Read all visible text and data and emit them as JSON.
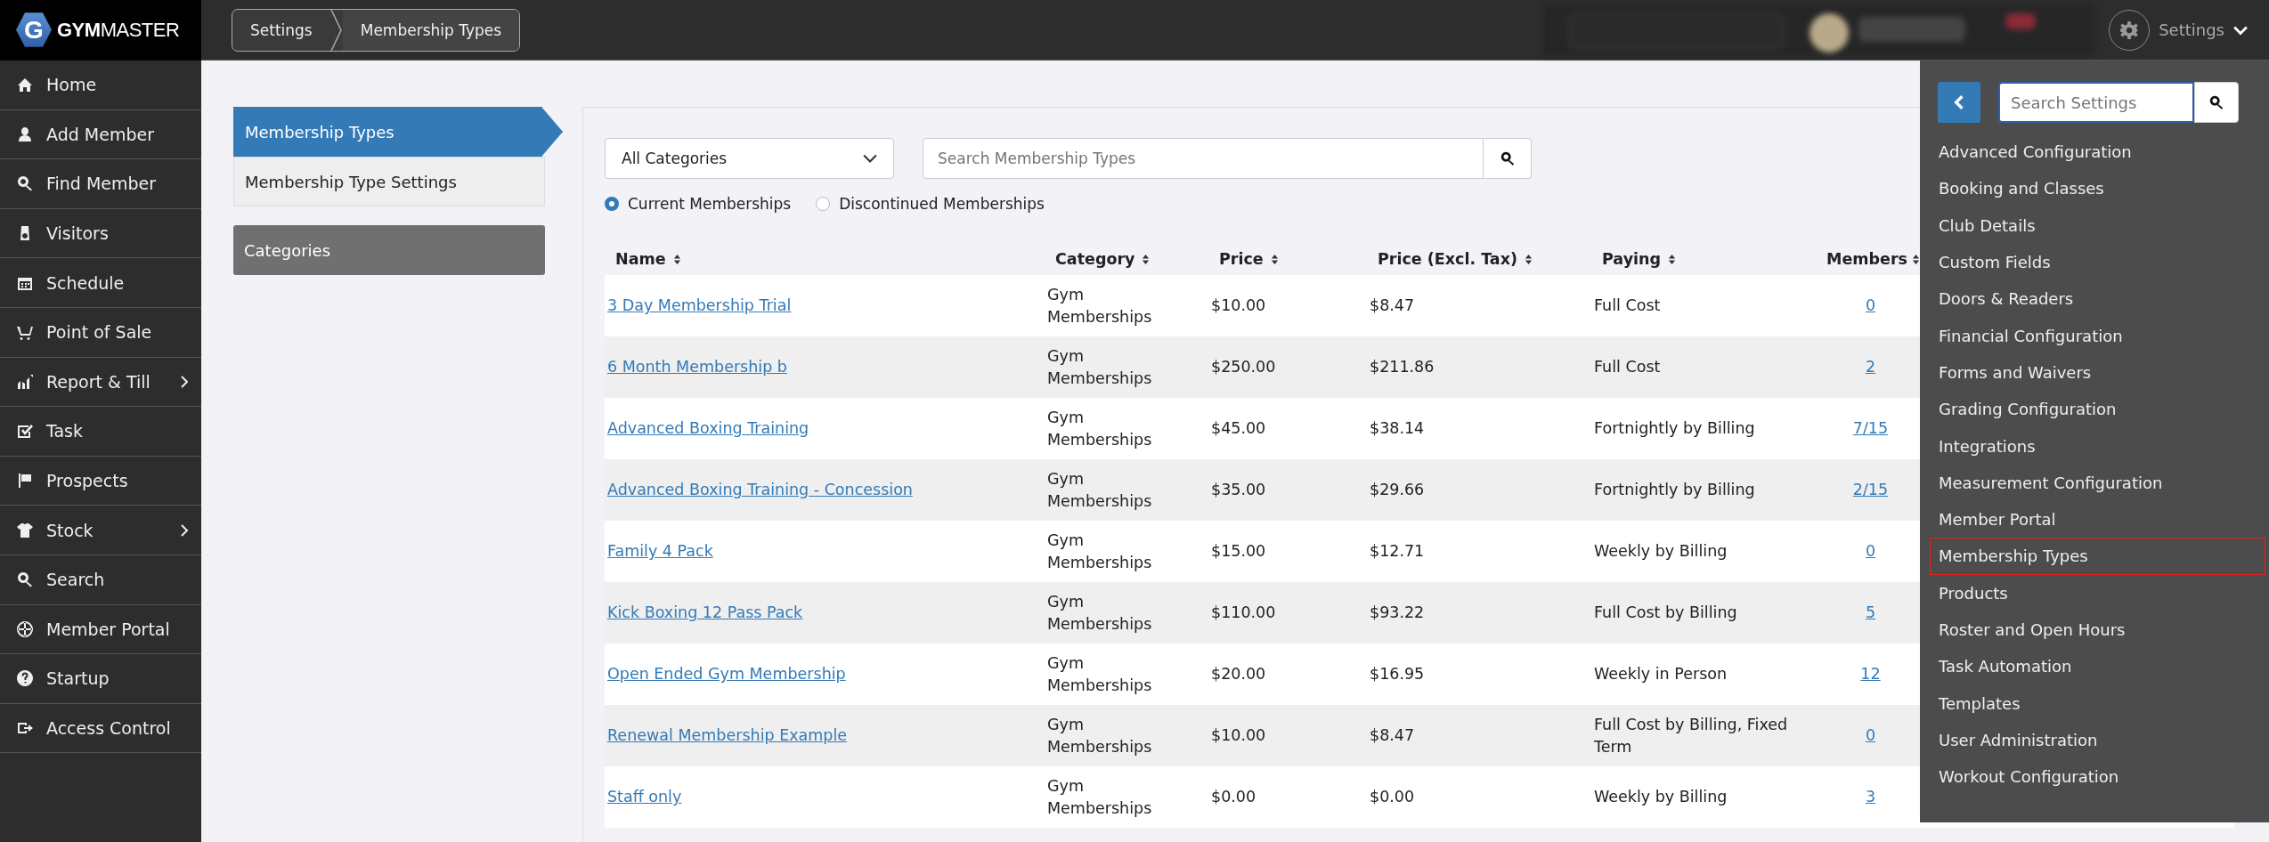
{
  "brand": {
    "logo_letter": "G",
    "name_bold": "GYM",
    "name_rest": "MASTER"
  },
  "breadcrumb": [
    "Settings",
    "Membership Types"
  ],
  "top_bar": {
    "settings_label": "Settings"
  },
  "sidebar": {
    "items": [
      {
        "label": "Home",
        "kind": "home",
        "has_submenu": false
      },
      {
        "label": "Add Member",
        "kind": "person",
        "has_submenu": false
      },
      {
        "label": "Find Member",
        "kind": "search",
        "has_submenu": false
      },
      {
        "label": "Visitors",
        "kind": "tag",
        "has_submenu": false
      },
      {
        "label": "Schedule",
        "kind": "calendar",
        "has_submenu": false
      },
      {
        "label": "Point of Sale",
        "kind": "cart",
        "has_submenu": false
      },
      {
        "label": "Report & Till",
        "kind": "chart",
        "has_submenu": true
      },
      {
        "label": "Task",
        "kind": "check",
        "has_submenu": false
      },
      {
        "label": "Prospects",
        "kind": "flag",
        "has_submenu": false
      },
      {
        "label": "Stock",
        "kind": "shirt",
        "has_submenu": true
      },
      {
        "label": "Search",
        "kind": "search",
        "has_submenu": false
      },
      {
        "label": "Member Portal",
        "kind": "globe",
        "has_submenu": false
      },
      {
        "label": "Startup",
        "kind": "question",
        "has_submenu": false
      },
      {
        "label": "Access Control",
        "kind": "exit",
        "has_submenu": false
      }
    ]
  },
  "subnav": {
    "items": [
      {
        "label": "Membership Types",
        "selected": true
      },
      {
        "label": "Membership Type Settings",
        "selected": false
      }
    ],
    "categories_button": "Categories"
  },
  "filters": {
    "category_select": "All Categories",
    "search": {
      "placeholder": "Search Membership Types"
    },
    "radios": [
      {
        "label": "Current Memberships",
        "selected": true
      },
      {
        "label": "Discontinued Memberships",
        "selected": false
      }
    ]
  },
  "table": {
    "columns": [
      "Name",
      "Category",
      "Price",
      "Price (Excl. Tax)",
      "Paying",
      "Members"
    ],
    "rows": [
      {
        "name": "3 Day Membership Trial",
        "category": "Gym Memberships",
        "price": "$10.00",
        "price_excl_tax": "$8.47",
        "paying": "Full Cost",
        "members": "0"
      },
      {
        "name": "6 Month Membership b",
        "category": "Gym Memberships",
        "price": "$250.00",
        "price_excl_tax": "$211.86",
        "paying": "Full Cost",
        "members": "2"
      },
      {
        "name": "Advanced Boxing Training",
        "category": "Gym Memberships",
        "price": "$45.00",
        "price_excl_tax": "$38.14",
        "paying": "Fortnightly by Billing",
        "members": "7/15"
      },
      {
        "name": "Advanced Boxing Training - Concession",
        "category": "Gym Memberships",
        "price": "$35.00",
        "price_excl_tax": "$29.66",
        "paying": "Fortnightly by Billing",
        "members": "2/15"
      },
      {
        "name": "Family 4 Pack",
        "category": "Gym Memberships",
        "price": "$15.00",
        "price_excl_tax": "$12.71",
        "paying": "Weekly by Billing",
        "members": "0"
      },
      {
        "name": "Kick Boxing 12 Pass Pack",
        "category": "Gym Memberships",
        "price": "$110.00",
        "price_excl_tax": "$93.22",
        "paying": "Full Cost by Billing",
        "members": "5"
      },
      {
        "name": "Open Ended Gym Membership",
        "category": "Gym Memberships",
        "price": "$20.00",
        "price_excl_tax": "$16.95",
        "paying": "Weekly in Person",
        "members": "12"
      },
      {
        "name": "Renewal Membership Example",
        "category": "Gym Memberships",
        "price": "$10.00",
        "price_excl_tax": "$8.47",
        "paying": "Full Cost by Billing, Fixed Term",
        "members": "0"
      },
      {
        "name": "Staff only",
        "category": "Gym Memberships",
        "price": "$0.00",
        "price_excl_tax": "$0.00",
        "paying": "Weekly by Billing",
        "members": "3"
      }
    ]
  },
  "settings_panel": {
    "search": {
      "placeholder": "Search Settings"
    },
    "items": [
      {
        "label": "Advanced Configuration",
        "selected": false
      },
      {
        "label": "Booking and Classes",
        "selected": false
      },
      {
        "label": "Club Details",
        "selected": false
      },
      {
        "label": "Custom Fields",
        "selected": false
      },
      {
        "label": "Doors & Readers",
        "selected": false
      },
      {
        "label": "Financial Configuration",
        "selected": false
      },
      {
        "label": "Forms and Waivers",
        "selected": false
      },
      {
        "label": "Grading Configuration",
        "selected": false
      },
      {
        "label": "Integrations",
        "selected": false
      },
      {
        "label": "Measurement Configuration",
        "selected": false
      },
      {
        "label": "Member Portal",
        "selected": false
      },
      {
        "label": "Membership Types",
        "selected": true
      },
      {
        "label": "Products",
        "selected": false
      },
      {
        "label": "Roster and Open Hours",
        "selected": false
      },
      {
        "label": "Task Automation",
        "selected": false
      },
      {
        "label": "Templates",
        "selected": false
      },
      {
        "label": "User Administration",
        "selected": false
      },
      {
        "label": "Workout Configuration",
        "selected": false
      }
    ]
  }
}
